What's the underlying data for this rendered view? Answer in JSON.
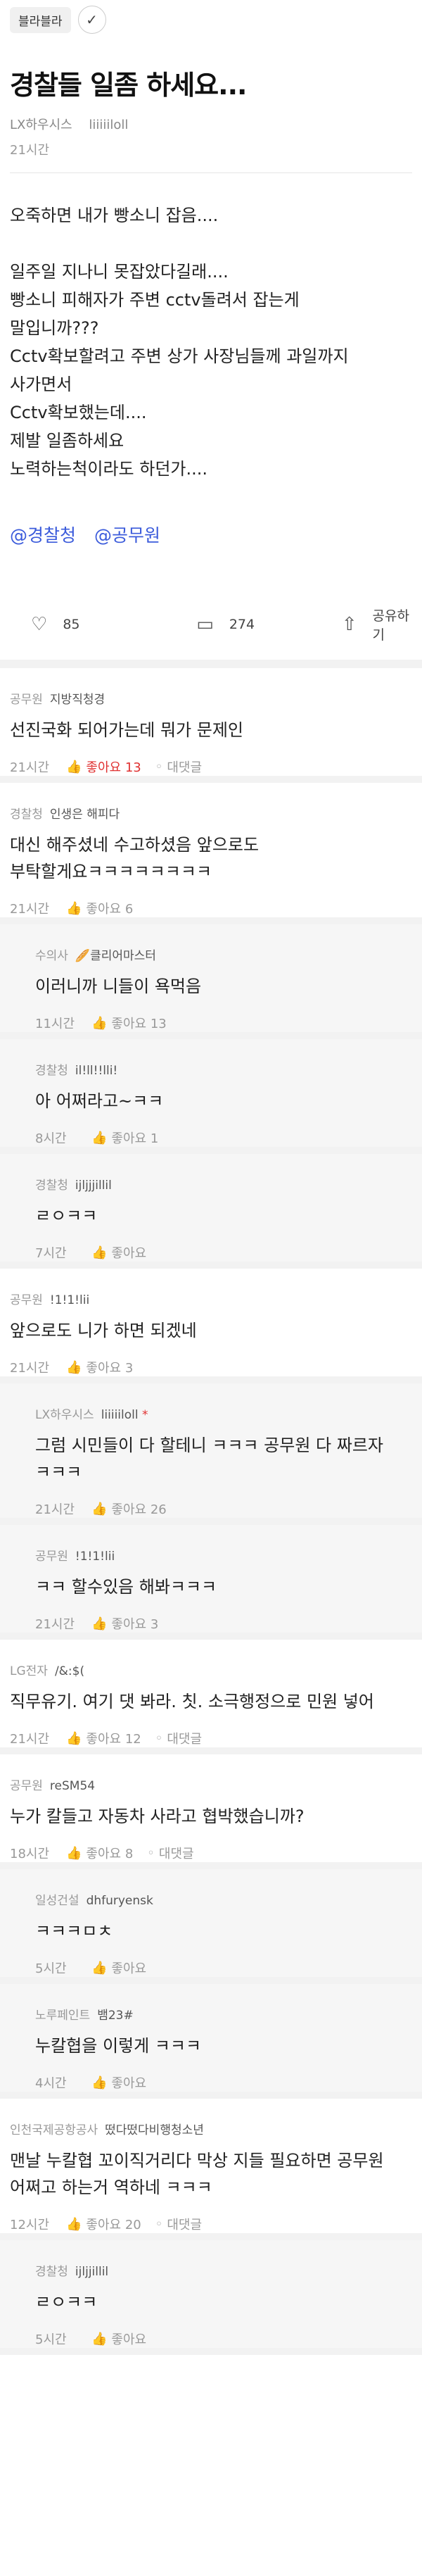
{
  "header": {
    "board": "블라블라",
    "check_icon": "✓"
  },
  "post": {
    "title": "경찰들 일좀 하세요...",
    "company": "LX하우시스",
    "nickname": "liiiiiloll",
    "time": "21시간",
    "body": [
      "오죽하면 내가 빵소니 잡음....",
      "",
      "일주일 지나니 못잡았다길래....",
      "빵소니 피해자가 주변 cctv돌려서 잡는게",
      "말입니까???",
      "Cctv확보할려고 주변 상가 사장님들께 과일까지",
      "사가면서",
      "Cctv확보했는데....",
      "제발 일좀하세요",
      "노력하는척이라도 하던가...."
    ],
    "tags": [
      "@경찰청",
      "@공무원"
    ],
    "likes": "85",
    "comments": "274",
    "share": "공유하기"
  },
  "comments": [
    {
      "reply": false,
      "company": "공무원",
      "nick": "지방직청경",
      "text": [
        "선진국화 되어가는데 뭐가 문제인"
      ],
      "time": "21시간",
      "like": "좋아요 13",
      "liked": true,
      "reply_label": "대댓글"
    },
    {
      "reply": false,
      "company": "경찰청",
      "nick": "인생은 해피다",
      "text": [
        "대신 해주셨네 수고하셨음 앞으로도",
        "부탁할게요ㅋㅋㅋㅋㅋㅋㅋㅋ"
      ],
      "time": "21시간",
      "like": "좋아요 6"
    },
    {
      "reply": true,
      "company": "수의사",
      "nick": "🥖클리어마스터",
      "text": [
        "이러니까 니들이 욕먹음"
      ],
      "time": "11시간",
      "like": "좋아요 13"
    },
    {
      "reply": true,
      "company": "경찰청",
      "nick": "il!ll!!lli!",
      "text": [
        "아 어쩌라고~ㅋㅋ"
      ],
      "time": "8시간",
      "like": "좋아요 1"
    },
    {
      "reply": true,
      "company": "경찰청",
      "nick": "ijljjjillil",
      "text": [
        "ㄹㅇㅋㅋ"
      ],
      "time": "7시간",
      "like": "좋아요"
    },
    {
      "reply": false,
      "company": "공무원",
      "nick": "!1!1!lii",
      "text": [
        "앞으로도 니가 하면 되겠네"
      ],
      "time": "21시간",
      "like": "좋아요 3"
    },
    {
      "reply": true,
      "company": "LX하우시스",
      "nick": "liiiiiloll",
      "star": "*",
      "text": [
        "그럼 시민들이 다 할테니 ㅋㅋㅋ 공무원 다 짜르자",
        "ㅋㅋㅋ"
      ],
      "time": "21시간",
      "like": "좋아요 26"
    },
    {
      "reply": true,
      "company": "공무원",
      "nick": "!1!1!lii",
      "text": [
        "ㅋㅋ 할수있음 해봐ㅋㅋㅋ"
      ],
      "time": "21시간",
      "like": "좋아요 3"
    },
    {
      "reply": false,
      "company": "LG전자",
      "nick": "/&:$(",
      "text": [
        "직무유기. 여기 댓 봐라. 칫. 소극행정으로 민원 넣어"
      ],
      "time": "21시간",
      "like": "좋아요 12",
      "reply_label": "대댓글"
    },
    {
      "reply": false,
      "company": "공무원",
      "nick": "reSM54",
      "text": [
        "누가 칼들고 자동차 사라고 협박했습니까?"
      ],
      "time": "18시간",
      "like": "좋아요 8",
      "reply_label": "대댓글"
    },
    {
      "reply": true,
      "company": "일성건설",
      "nick": "dhfuryensk",
      "text": [
        "ㅋㅋㅋㅁㅊ"
      ],
      "time": "5시간",
      "like": "좋아요"
    },
    {
      "reply": true,
      "company": "노루페인트",
      "nick": "뱀23#",
      "text": [
        "누칼협을 이렇게 ㅋㅋㅋ"
      ],
      "time": "4시간",
      "like": "좋아요"
    },
    {
      "reply": false,
      "company": "인천국제공항공사",
      "nick": "떴다떴다비행청소년",
      "text": [
        "맨날 누칼협 꼬이직거리다 막상 지들 필요하면 공무원",
        "어쩌고 하는거 역하네 ㅋㅋㅋ"
      ],
      "time": "12시간",
      "like": "좋아요 20",
      "reply_label": "대댓글"
    },
    {
      "reply": true,
      "company": "경찰청",
      "nick": "ijljjillil",
      "text": [
        "ㄹㅇㅋㅋ"
      ],
      "time": "5시간",
      "like": "좋아요"
    }
  ]
}
